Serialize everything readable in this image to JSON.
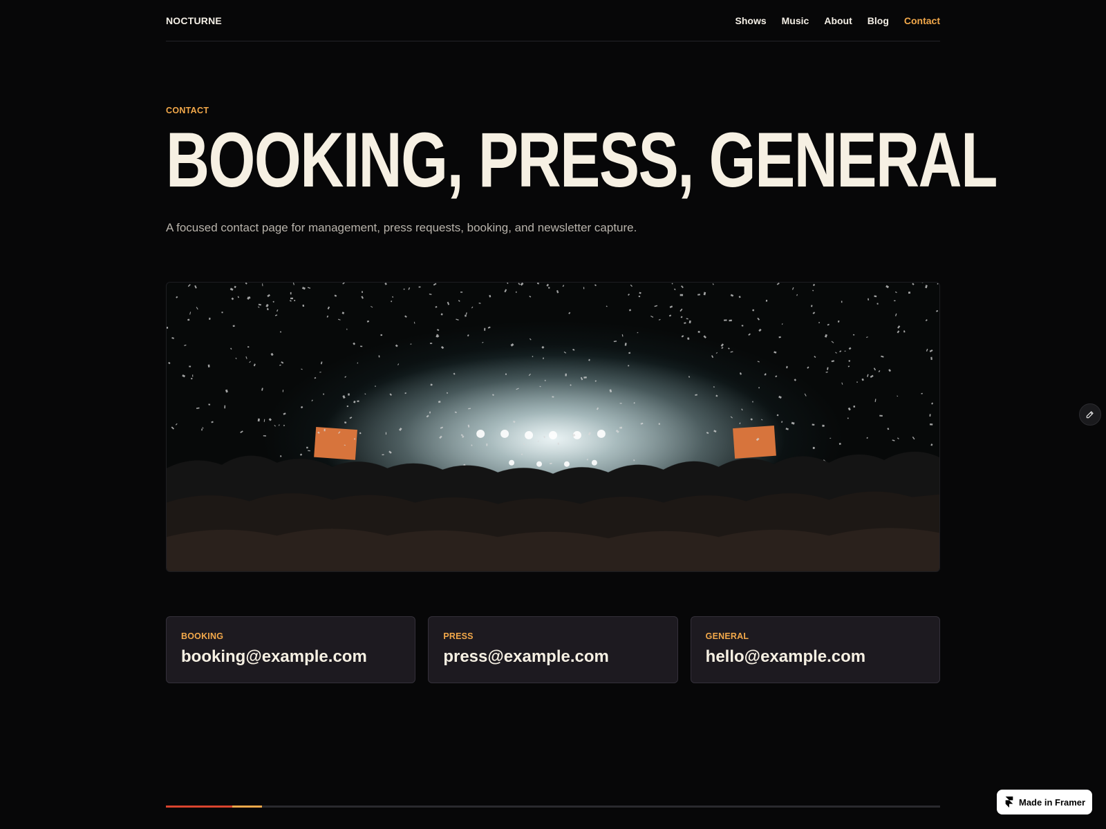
{
  "header": {
    "brand": "NOCTURNE",
    "nav": [
      {
        "label": "Shows"
      },
      {
        "label": "Music"
      },
      {
        "label": "About"
      },
      {
        "label": "Blog"
      },
      {
        "label": "Contact",
        "active": true
      }
    ]
  },
  "hero": {
    "eyebrow": "CONTACT",
    "title": "BOOKING, PRESS, GENERAL",
    "subtitle": "A focused contact page for management, press requests, booking, and newsletter capture."
  },
  "contacts": [
    {
      "label": "BOOKING",
      "email": "booking@example.com"
    },
    {
      "label": "PRESS",
      "email": "press@example.com"
    },
    {
      "label": "GENERAL",
      "email": "hello@example.com"
    }
  ],
  "badge": {
    "label": "Made in Framer",
    "icon": "framer-logo-icon"
  },
  "edit": {
    "icon": "pencil-icon"
  },
  "progress": {
    "fraction": 0.124
  },
  "colors": {
    "background": "#070708",
    "accent": "#f2a84a",
    "accent_red": "#d9442e",
    "card_bg": "#1d1a20",
    "text": "#f6f0e3"
  }
}
